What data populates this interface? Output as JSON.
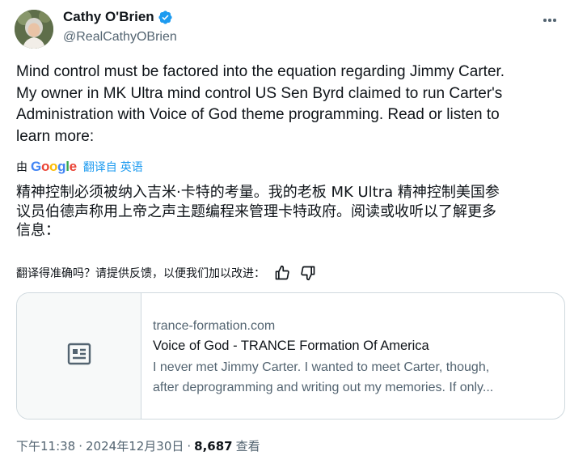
{
  "author": {
    "name": "Cathy O'Brien",
    "handle": "@RealCathyOBrien",
    "verified_color": "#1d9bf0"
  },
  "tweet": {
    "text_lines": [
      "Mind control must be factored into the equation regarding Jimmy Carter.",
      "My owner in MK Ultra mind control US Sen Byrd claimed to run Carter's",
      "Administration with Voice of God theme programming. Read or listen to",
      "learn more:"
    ]
  },
  "translation": {
    "by_label": "由",
    "provider": "Google",
    "from_label": "翻译自 英语",
    "text_lines": [
      "精神控制必须被纳入吉米·卡特的考量。我的老板 MK Ultra 精神控制美国参",
      "议员伯德声称用上帝之声主题编程来管理卡特政府。阅读或收听以了解更多",
      "信息："
    ],
    "feedback_prompt": "翻译得准确吗？请提供反馈，以便我们加以改进："
  },
  "link_card": {
    "domain": "trance-formation.com",
    "title": "Voice of God - TRANCE Formation Of America",
    "description_lines": [
      "I never met Jimmy Carter. I wanted to meet Carter, though,",
      "after deprogramming and writing out my memories. If only..."
    ]
  },
  "meta": {
    "time": "下午11:38",
    "separator": "·",
    "date": "2024年12月30日",
    "views_count": "8,687",
    "views_label": "查看"
  },
  "icons": {
    "more": "more-horizontal-icon",
    "verified": "verified-badge-icon",
    "thumbs_up": "thumbs-up-icon",
    "thumbs_down": "thumbs-down-icon",
    "article": "article-icon"
  }
}
